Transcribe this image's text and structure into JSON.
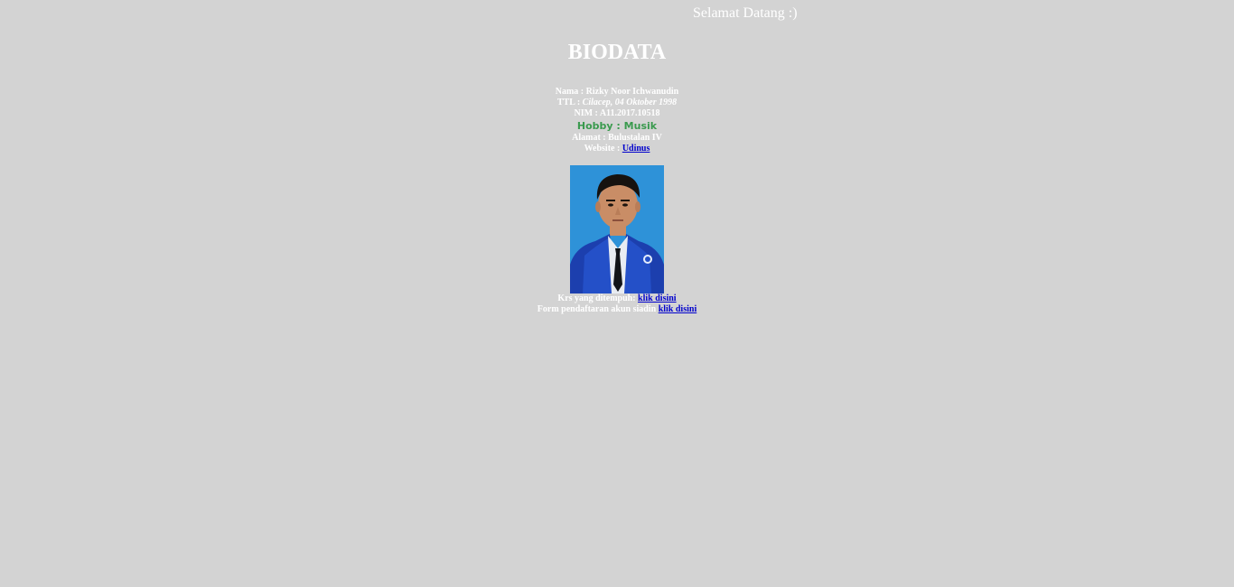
{
  "marquee": {
    "text": "Selamat Datang :)"
  },
  "title": "BIODATA",
  "biodata": {
    "nama_label": "Nama : ",
    "nama_value": "Rizky Noor Ichwanudin",
    "ttl_label": "TTL : ",
    "ttl_value": "Cilacep, 04 Oktober 1998",
    "nim_label": "NIM : ",
    "nim_value": "A11.2017.10518",
    "hobby": "Hobby : Musik",
    "alamat_label": "Alamat : ",
    "alamat_value": "Bulustalan IV",
    "website_label": "Website : ",
    "website_link": "Udinus"
  },
  "photo": {
    "icon": "student-portrait-photo"
  },
  "links": {
    "krs_label": "Krs yang ditempuh: ",
    "krs_link": "klik disini",
    "form_label": "Form pendaftaran akun siadin ",
    "form_link": "klik disini"
  },
  "colors": {
    "background": "#d3d3d3",
    "text": "#ffffff",
    "hobby": "#3a9a4e",
    "link": "#0000cc",
    "photo_background": "#2e92d8"
  }
}
